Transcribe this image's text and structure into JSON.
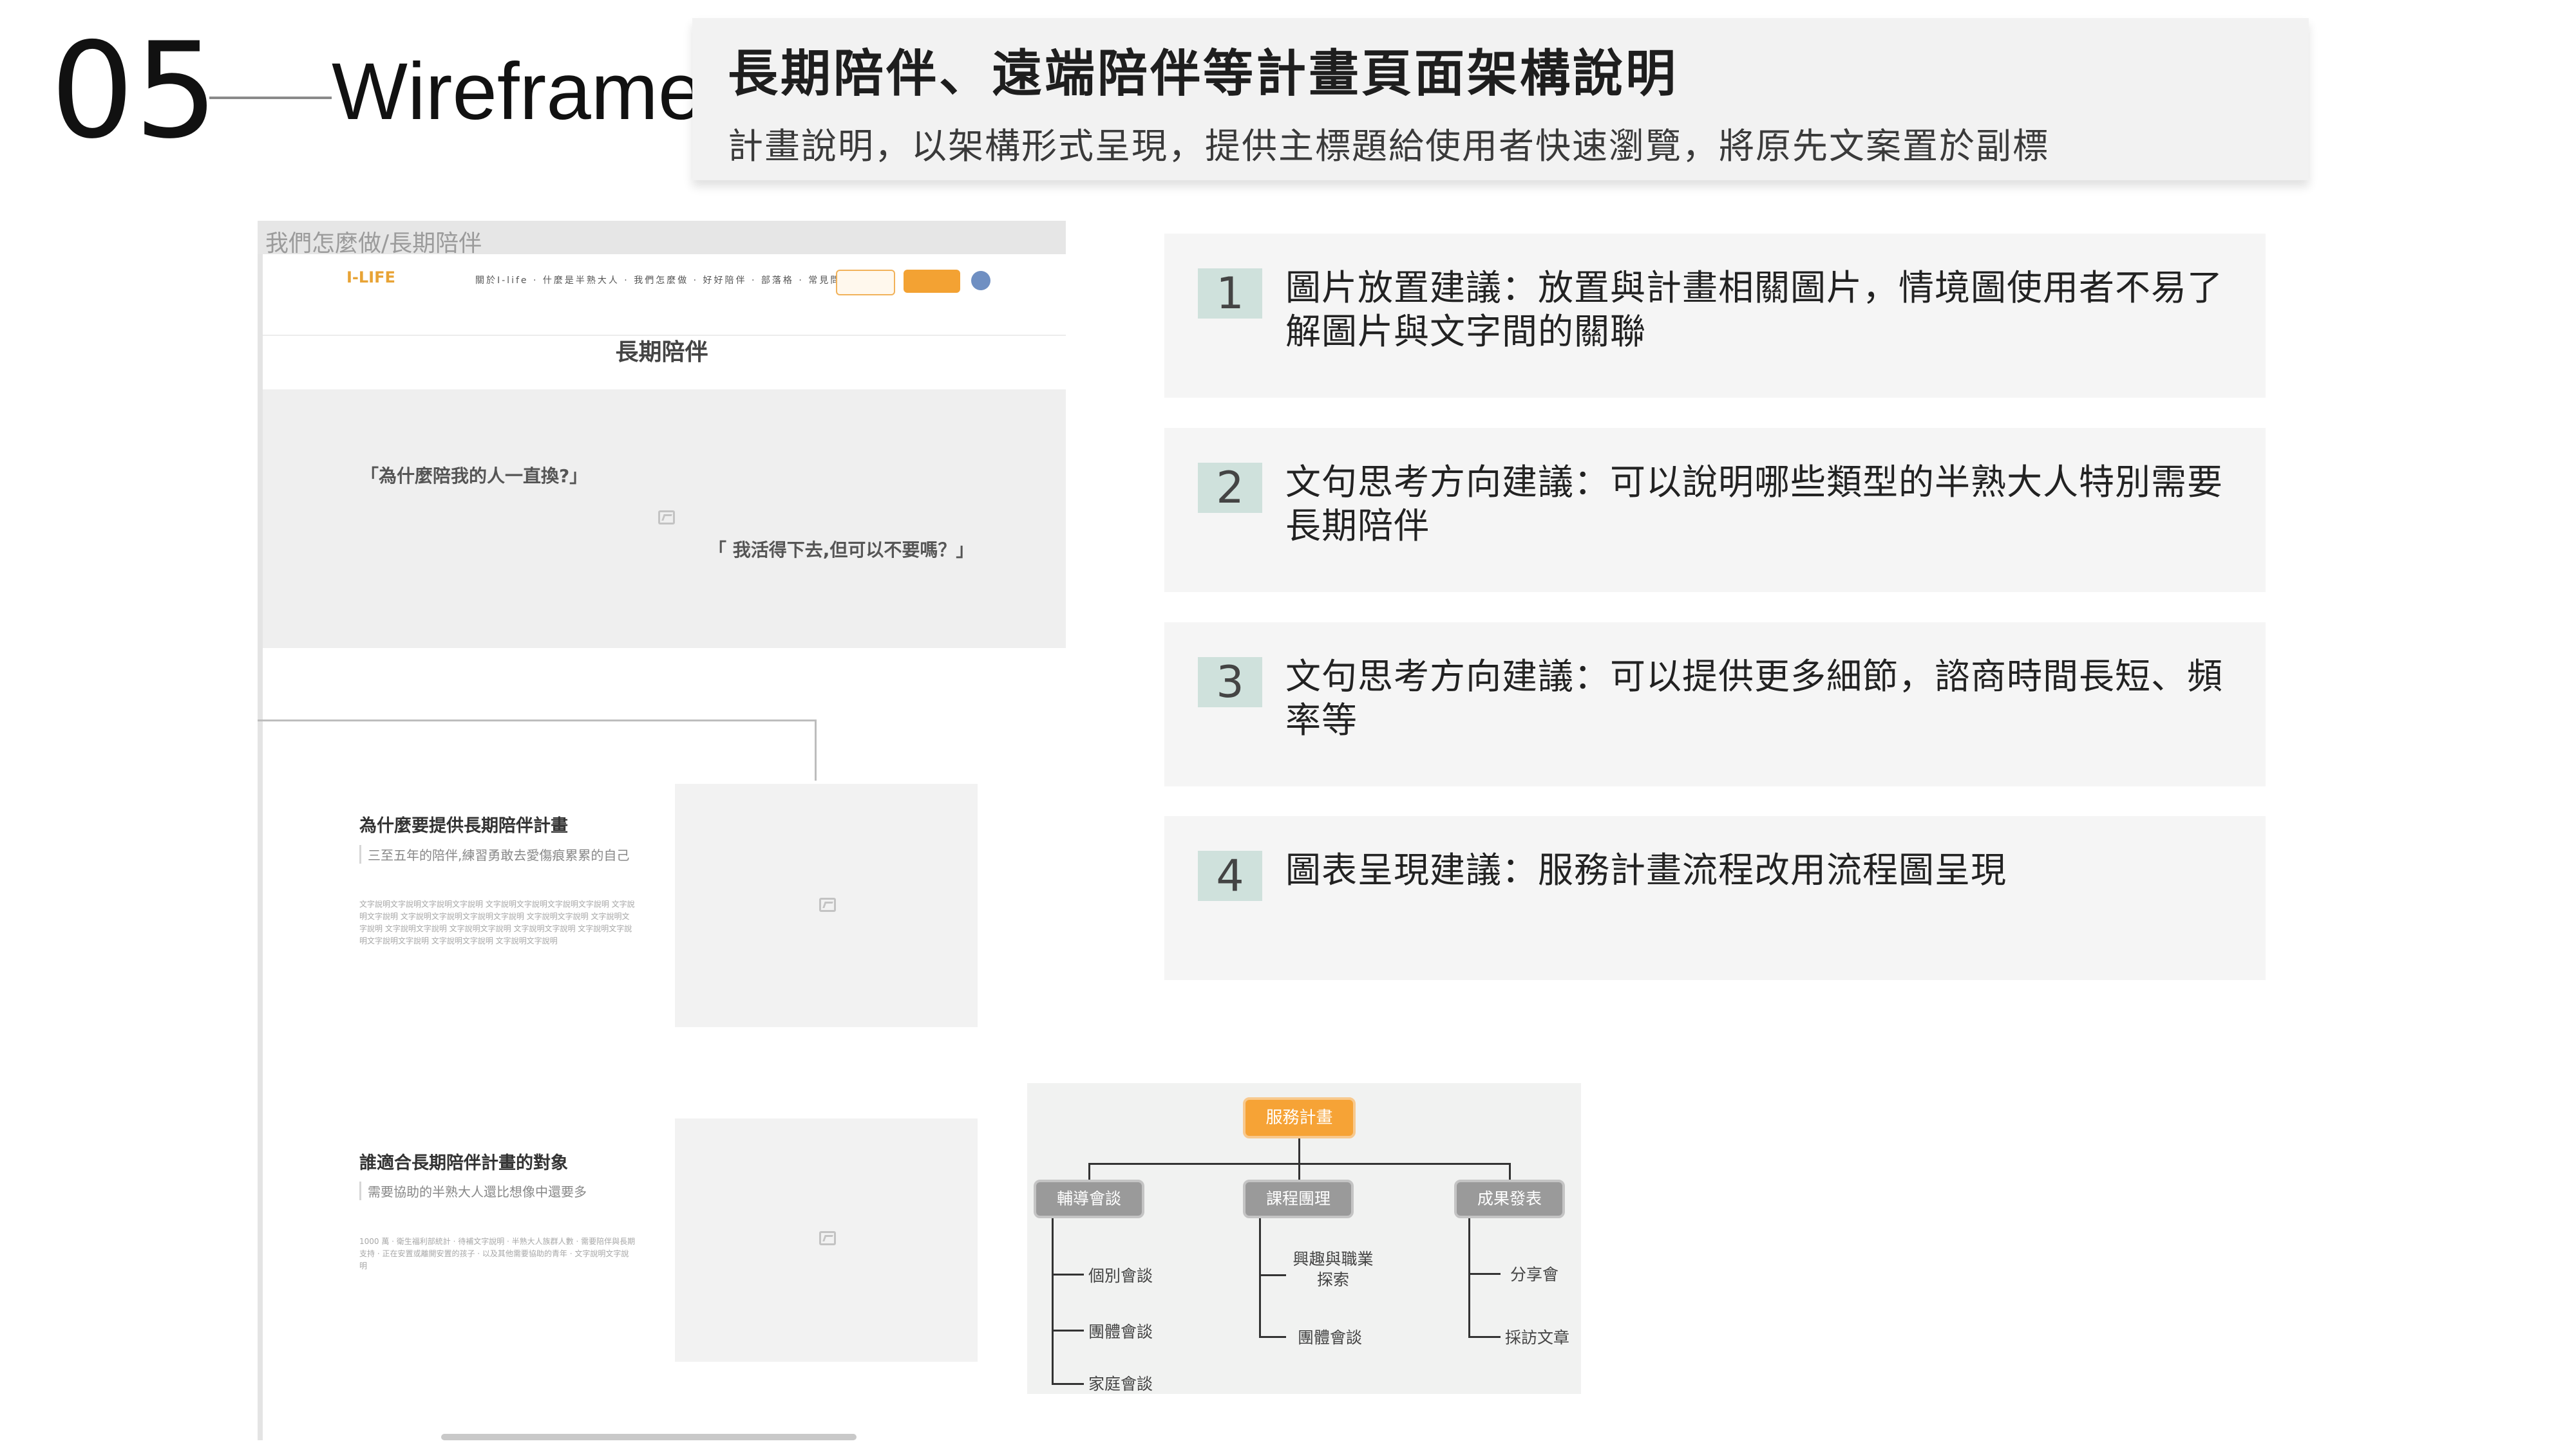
{
  "header": {
    "section_number": "05",
    "section_title": "Wireframe",
    "title": "長期陪伴、遠端陪伴等計畫頁面架構說明",
    "subtitle": "計畫說明，以架構形式呈現，提供主標題給使用者快速瀏覽，將原先文案置於副標"
  },
  "wireframe": {
    "breadcrumb": "我們怎麼做/長期陪伴",
    "logo": "I-LIFE",
    "nav_items": "關於I-life · 什麼是半熟大人 · 我們怎麼做 · 好好陪伴 · 部落格 · 常見問題",
    "page_title": "長期陪伴",
    "hero_quote_1": "「為什麼陪我的人一直換?」",
    "hero_quote_2": "「 我活得下去,但可以不要嗎？」",
    "section1": {
      "heading": "為什麼要提供長期陪伴計畫",
      "subheading": "三至五年的陪伴,練習勇敢去愛傷痕累累的自己",
      "body": "文字說明文字說明文字說明文字說明 文字說明文字說明文字說明文字說明 文字說明文字說明 文字說明文字說明文字說明文字說明 文字說明文字說明 文字說明文字說明 文字說明文字說明 文字說明文字說明 文字說明文字說明 文字說明文字說明文字說明文字說明 文字說明文字說明 文字說明文字說明"
    },
    "section2": {
      "heading": "誰適合長期陪伴計畫的對象",
      "subheading": "需要協助的半熟大人還比想像中還要多",
      "body": "1000 萬 · 衛生福利部統計 · 待補文字說明 · 半熟大人族群人數 · 需要陪伴與長期支持 · 正在安置或離開安置的孩子 · 以及其他需要協助的青年 · 文字說明文字說明"
    }
  },
  "flowchart": {
    "root": "服務計畫",
    "columns": [
      {
        "label": "輔導會談",
        "leaves": [
          "個別會談",
          "團體會談",
          "家庭會談"
        ]
      },
      {
        "label": "課程團理",
        "leaves": [
          "興趣與職業探索",
          "團體會談"
        ]
      },
      {
        "label": "成果發表",
        "leaves": [
          "分享會",
          "採訪文章"
        ]
      }
    ]
  },
  "suggestions": [
    {
      "number": "1",
      "text": "圖片放置建議：放置與計畫相關圖片，情境圖使用者不易了解圖片與文字間的關聯"
    },
    {
      "number": "2",
      "text": "文句思考方向建議：可以說明哪些類型的半熟大人特別需要長期陪伴"
    },
    {
      "number": "3",
      "text": "文句思考方向建議：可以提供更多細節，諮商時間長短、頻率等"
    },
    {
      "number": "4",
      "text": "圖表呈現建議：服務計畫流程改用流程圖呈現"
    }
  ]
}
